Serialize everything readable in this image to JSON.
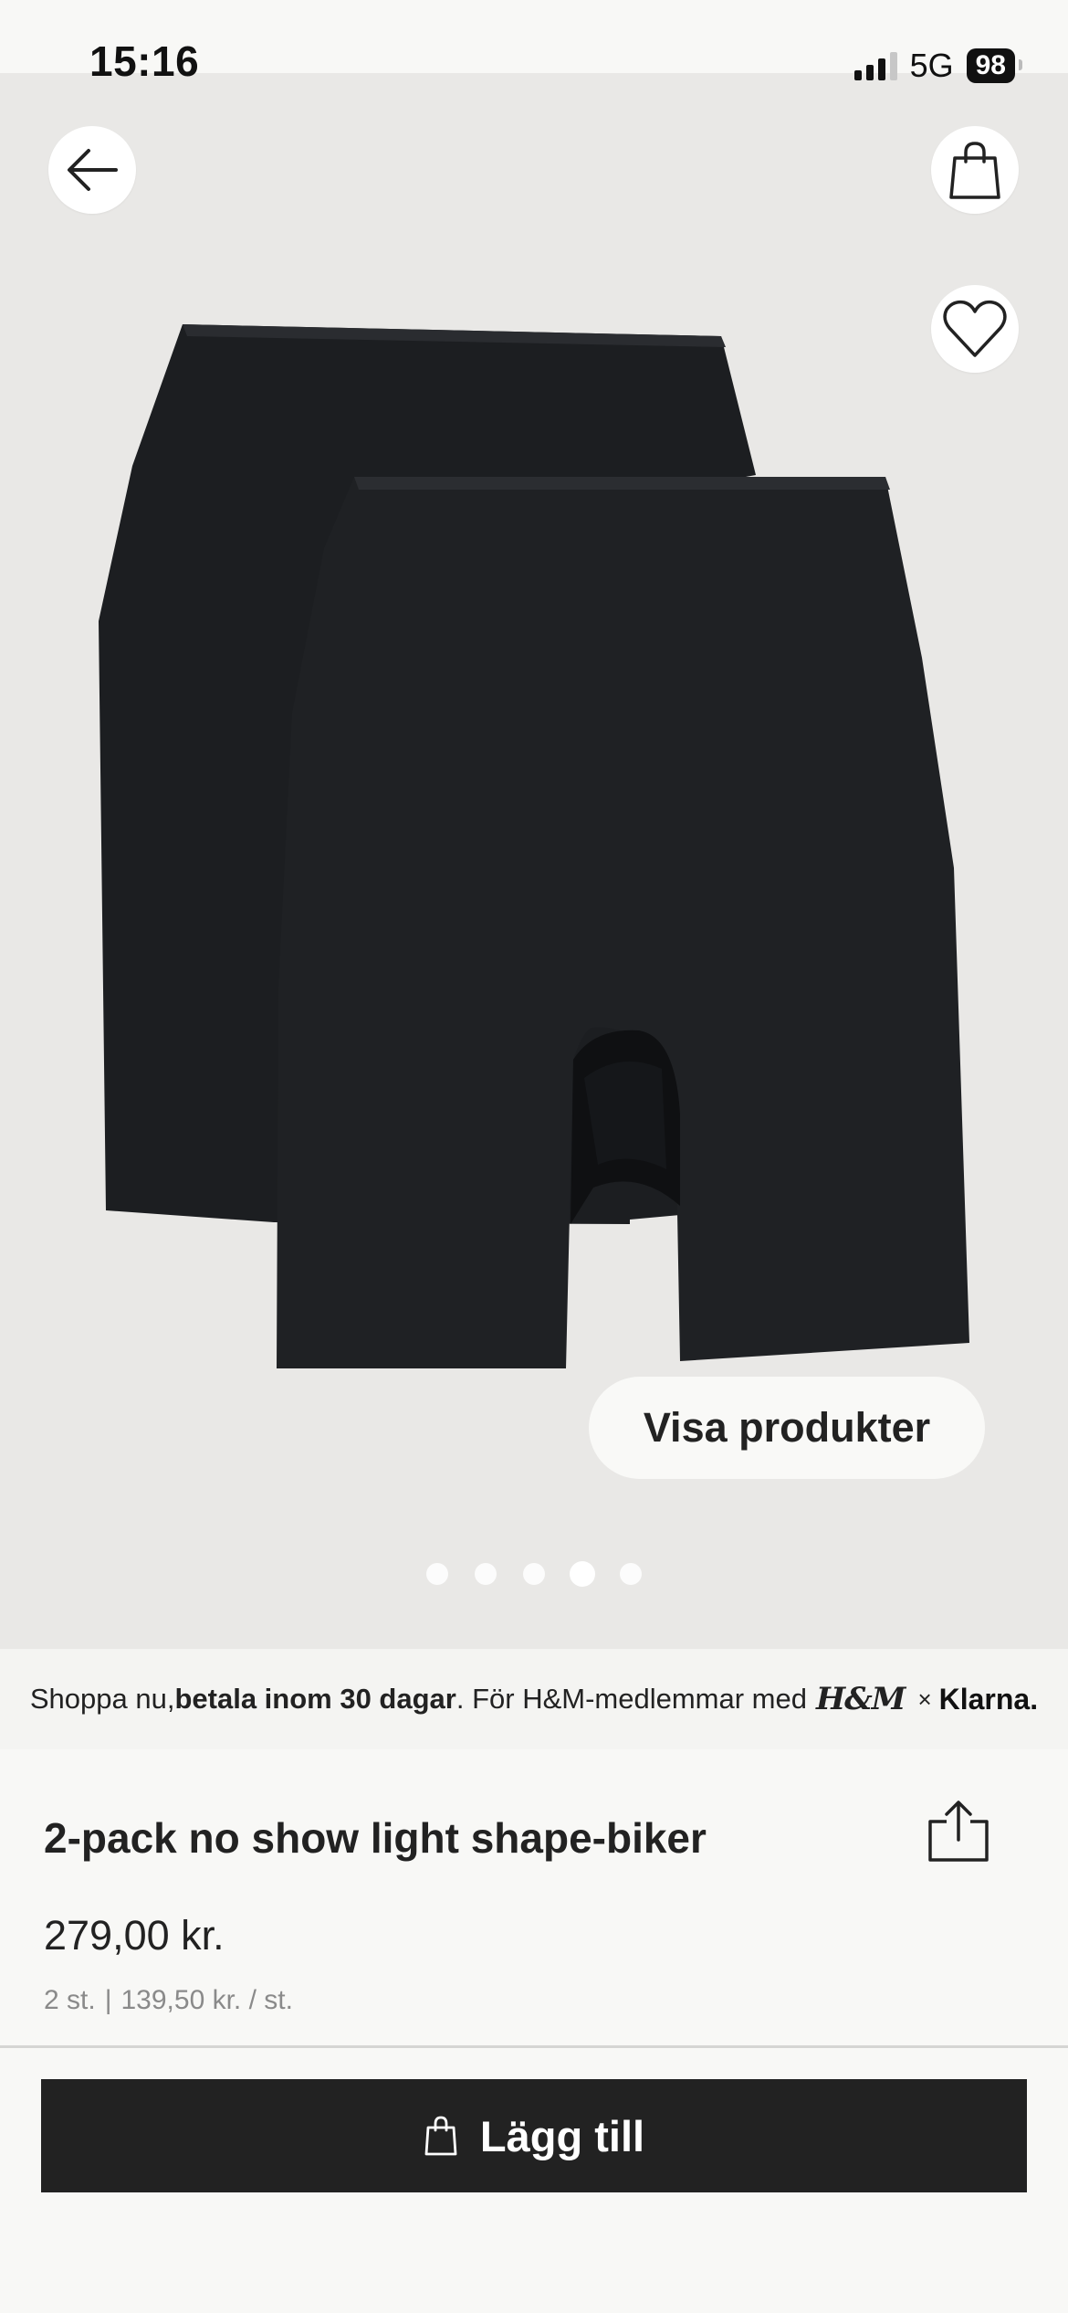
{
  "status_bar": {
    "time": "15:16",
    "network": "5G",
    "battery": "98"
  },
  "hero": {
    "show_products_label": "Visa produkter",
    "image_count": 5,
    "active_image_index": 3
  },
  "klarna": {
    "text_start": "Shoppa nu, ",
    "text_bold": "betala inom 30 dagar",
    "text_end": ". För H&M-medlemmar med",
    "hm_logo": "H&M",
    "times": "×",
    "klarna_logo": "Klarna."
  },
  "product": {
    "title": "2-pack no show light shape-biker",
    "price": "279,00 kr.",
    "quantity": "2 st.",
    "separator": "|",
    "unit_price": "139,50 kr. / st."
  },
  "actions": {
    "add_to_bag_label": "Lägg till"
  },
  "icons": {
    "back": "arrow-left-icon",
    "bag": "shopping-bag-icon",
    "favorite": "heart-icon",
    "share": "share-icon"
  },
  "colors": {
    "hero_background": "#e9e8e6",
    "product_fabric": "#1e2023",
    "button_dark": "#222222",
    "page_background": "#f8f8f6"
  }
}
